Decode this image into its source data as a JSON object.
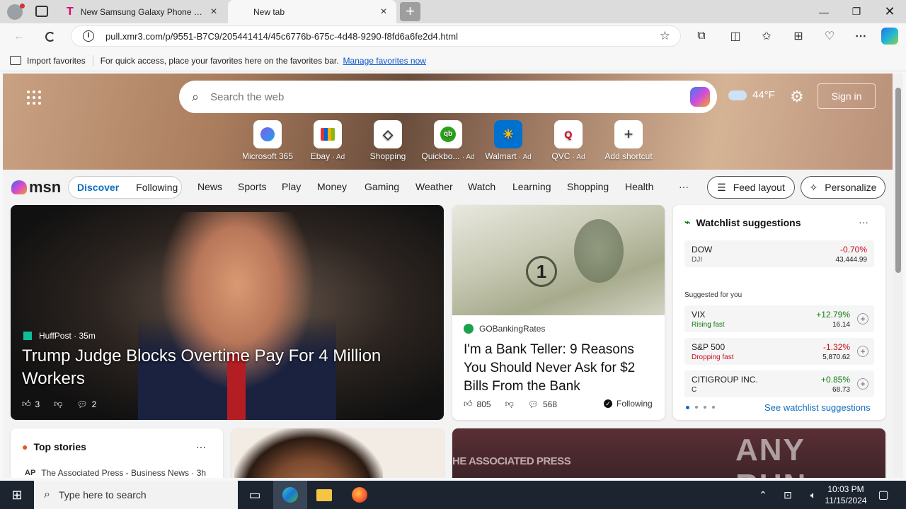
{
  "tabs": [
    {
      "title": "New Samsung Galaxy Phone Dea",
      "icon": "t-mobile-icon"
    },
    {
      "title": "New tab"
    }
  ],
  "address": {
    "url": "pull.xmr3.com/p/9551-B7C9/205441414/45c6776b-675c-4d48-9290-f8fd6a6fe2d4.html"
  },
  "favorites_bar": {
    "import_label": "Import favorites",
    "hint": "For quick access, place your favorites here on the favorites bar.",
    "manage_link": "Manage favorites now"
  },
  "search": {
    "placeholder": "Search the web"
  },
  "weather": {
    "temp": "44°F",
    "icon": "cloud-icon"
  },
  "sign_in": "Sign in",
  "shortcuts": [
    {
      "label": "Microsoft 365",
      "ad": ""
    },
    {
      "label": "Ebay",
      "ad": "· Ad"
    },
    {
      "label": "Shopping",
      "ad": ""
    },
    {
      "label": "Quickbo...",
      "ad": "· Ad"
    },
    {
      "label": "Walmart",
      "ad": "· Ad"
    },
    {
      "label": "QVC",
      "ad": "· Ad"
    },
    {
      "label": "Add shortcut",
      "ad": ""
    }
  ],
  "msn": {
    "logo": "msn",
    "tabs": [
      "Discover",
      "Following"
    ],
    "nav": [
      "News",
      "Sports",
      "Play",
      "Money",
      "Gaming",
      "Weather",
      "Watch",
      "Learning",
      "Shopping",
      "Health"
    ],
    "more": "···",
    "feed_layout": "Feed layout",
    "personalize": "Personalize"
  },
  "lead": {
    "source": "HuffPost",
    "age": "· 35m",
    "title": "Trump Judge Blocks Overtime Pay For 4 Million Workers",
    "likes": "3",
    "comments": "2"
  },
  "bank": {
    "source": "GOBankingRates",
    "title": "I'm a Bank Teller: 9 Reasons You Should Never Ask for $2 Bills From the Bank",
    "likes": "805",
    "comments": "568",
    "following": "Following"
  },
  "watchlist": {
    "title": "Watchlist suggestions",
    "more": "···",
    "suggested": "Suggested for you",
    "link": "See watchlist suggestions",
    "dow": {
      "name": "DOW",
      "sub": "DJI",
      "change": "-0.70%",
      "value": "43,444.99"
    },
    "rows": [
      {
        "name": "VIX",
        "status": "Rising fast",
        "change": "+12.79%",
        "value": "16.14",
        "color": "#107c10"
      },
      {
        "name": "S&P 500",
        "status": "Dropping fast",
        "change": "-1.32%",
        "value": "5,870.62",
        "color": "#c50f1f"
      },
      {
        "name": "CITIGROUP INC.",
        "status": "C",
        "change": "+0.85%",
        "value": "68.73",
        "color": "#107c10"
      }
    ]
  },
  "top_stories": {
    "title": "Top stories",
    "more": "···",
    "source": "The Associated Press - Business News · 3h"
  },
  "ap_card": {
    "text": "HE ASSOCIATED PRESS"
  },
  "watermark": "ANY RUN",
  "taskbar": {
    "search_placeholder": "Type here to search",
    "time": "10:03 PM",
    "date": "11/15/2024"
  }
}
